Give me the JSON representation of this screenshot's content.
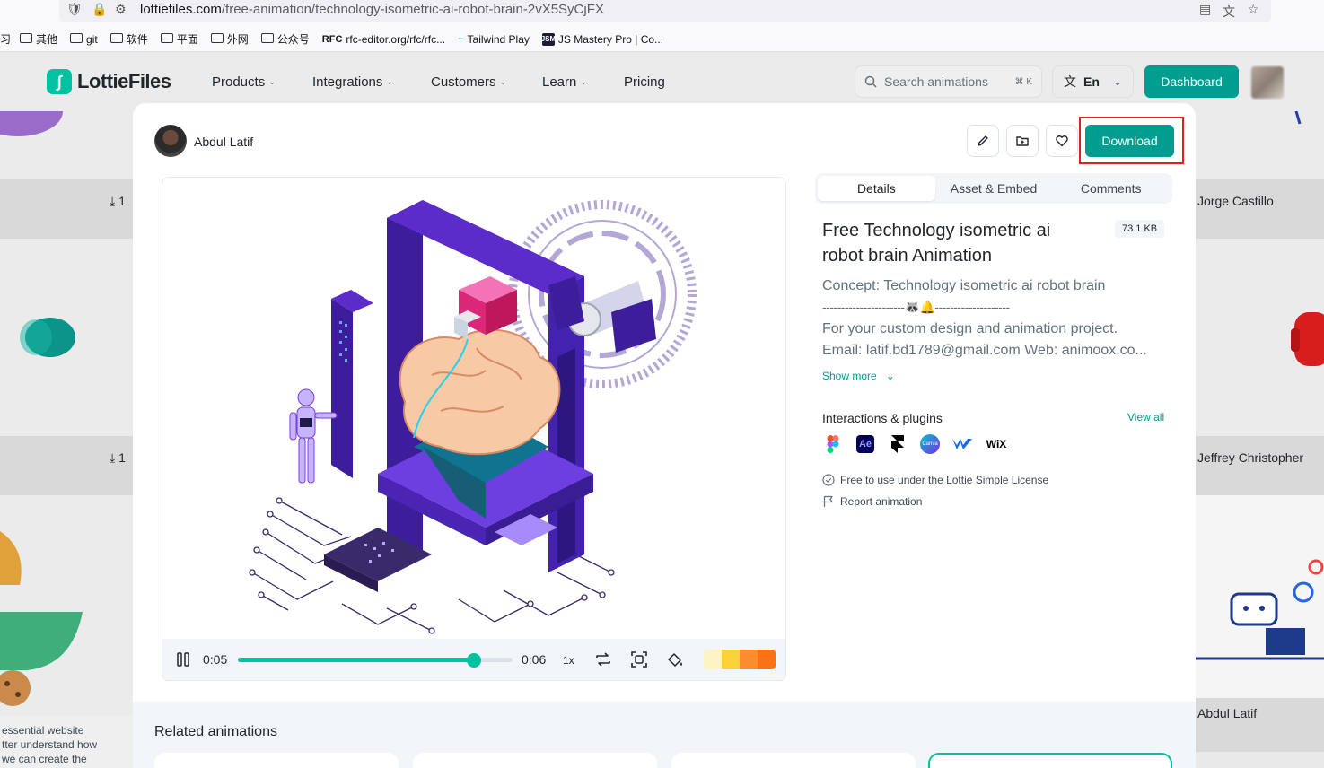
{
  "browser": {
    "url_host": "lottiefiles.com",
    "url_path": "/free-animation/technology-isometric-ai-robot-brain-2vX5SyCjFX",
    "bookmarks": [
      {
        "label": "其他",
        "type": "folder"
      },
      {
        "label": "git",
        "type": "folder"
      },
      {
        "label": "软件",
        "type": "folder"
      },
      {
        "label": "平面",
        "type": "folder"
      },
      {
        "label": "外网",
        "type": "folder"
      },
      {
        "label": "公众号",
        "type": "folder"
      },
      {
        "label": "rfc-editor.org/rfc/rfc...",
        "type": "site",
        "icon": "RFC"
      },
      {
        "label": "Tailwind Play",
        "type": "site",
        "icon": "~"
      },
      {
        "label": "JS Mastery Pro | Co...",
        "type": "site",
        "icon": "JSM"
      }
    ],
    "bookmark_lead": "习"
  },
  "header": {
    "logo_text": "LottieFiles",
    "nav": [
      "Products",
      "Integrations",
      "Customers",
      "Learn",
      "Pricing"
    ],
    "search_placeholder": "Search animations",
    "search_shortcut": "⌘ K",
    "lang": "En",
    "dashboard_label": "Dashboard"
  },
  "background": {
    "names": [
      "Jorge Castillo",
      "Jeffrey Christopher",
      "Abdul Latif"
    ],
    "download_counts": [
      "1",
      "1"
    ],
    "snippet_lines": [
      "essential website",
      "tter understand how",
      "we can create the"
    ]
  },
  "modal": {
    "author": "Abdul Latif",
    "download_label": "Download",
    "tabs": [
      "Details",
      "Asset & Embed",
      "Comments"
    ],
    "active_tab": "Details",
    "title": "Free Technology isometric ai robot brain Animation",
    "file_size": "73.1 KB",
    "description": [
      "Concept: Technology isometric ai robot brain",
      "----------------------🦝🔔--------------------",
      "For your custom design and animation project.",
      "Email: latif.bd1789@gmail.com Web: animoox.co..."
    ],
    "show_more": "Show more",
    "integrations_title": "Interactions & plugins",
    "view_all": "View all",
    "plugins": [
      "figma-icon",
      "after-effects-icon",
      "framer-icon",
      "canva-icon",
      "webflow-icon",
      "wix-icon"
    ],
    "plugin_labels": {
      "ae": "Ae",
      "canva": "Canva",
      "wix": "WiX"
    },
    "license_text": "Free to use under the Lottie Simple License",
    "report_text": "Report animation",
    "player": {
      "current_time": "0:05",
      "total_time": "0:06",
      "progress": 0.86,
      "speed": "1x",
      "swatches": [
        "#fdf3c4",
        "#fbd13b",
        "#fb8c2f",
        "#f97316"
      ]
    },
    "related_title": "Related animations"
  },
  "colors": {
    "brand": "#019d91",
    "accent": "#00c1a2",
    "highlight": "#e21f1f"
  }
}
